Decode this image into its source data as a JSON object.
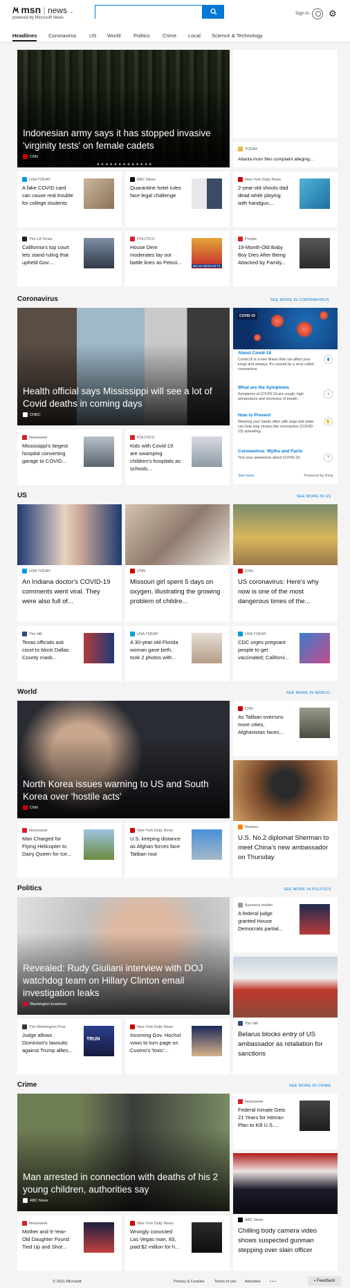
{
  "header": {
    "logo_msn": "msn",
    "logo_news": "news",
    "logo_sub": "powered by Microsoft News",
    "search_placeholder": "",
    "signin": "Sign in"
  },
  "nav": [
    "Headlines",
    "Coronavirus",
    "US",
    "World",
    "Politics",
    "Crime",
    "Local",
    "Science & Technology"
  ],
  "headlines": {
    "hero": {
      "title": "Indonesian army says it has stopped invasive 'virginity tests' on female cadets",
      "source": "CNN"
    },
    "side": {
      "source": "TODAY",
      "title": "Atlanta mom files complaint alleging..."
    },
    "row1": [
      {
        "source": "USA TODAY",
        "title": "A fake COVID card can cause real trouble for college students"
      },
      {
        "source": "BBC News",
        "title": "Quarantine hotel rules face legal challenge"
      },
      {
        "source": "New York Daily News",
        "title": "2-year-old shoots dad dead while playing with handgun,..."
      }
    ],
    "row2": [
      {
        "source": "The LA Times",
        "title": "California's top court lets stand ruling that upheld Gov...."
      },
      {
        "source": "POLITICO",
        "title": "House Dem moderates lay out battle lines as Pelosi..."
      },
      {
        "source": "People",
        "title": "19-Month-Old Baby Boy Dies After Being Attacked by Family..."
      }
    ],
    "sign_text": "BICAN RESCUE PL"
  },
  "coronavirus": {
    "section": "Coronavirus",
    "see_more": "SEE MORE IN CORONAVIRUS",
    "hero": {
      "title": "Health official says Mississippi will see a lot of Covid deaths in coming days",
      "source": "CNBC"
    },
    "row": [
      {
        "source": "Newsweek",
        "title": "Mississippi's largest hospital converting garage to COVID..."
      },
      {
        "source": "POLITICO",
        "title": "Kids with Covid-19 are swamping children's hospitals as schools..."
      }
    ],
    "panel": {
      "badge": "COVID 19",
      "items": [
        {
          "head": "About Covid-19",
          "body": "Covid-19 is a new illness that can affect your lungs and airways. It's caused by a virus called coronavirus."
        },
        {
          "head": "What are the Symptoms",
          "body": "Symptoms of COVID-19 are cough, high temperature and shortness of breath."
        },
        {
          "head": "How to Prevent",
          "body": "Washing your hands often with soap and water can help stop viruses like coronavirus (COVID-19) spreading."
        },
        {
          "head": "Coronavirus: Myths and Facts",
          "body": "Test your awareness about COVID-19."
        }
      ],
      "see_more": "See more",
      "powered": "Powered by Bing"
    }
  },
  "us": {
    "section": "US",
    "see_more": "SEE MORE IN US",
    "cards": [
      {
        "source": "USA TODAY",
        "title": "An Indiana doctor's COVID-19 comments went viral. They were also full of..."
      },
      {
        "source": "CNN",
        "title": "Missouri girl spent 5 days on oxygen, illustrating the growing problem of childre..."
      },
      {
        "source": "CNN",
        "title": "US coronavirus: Here's why now is one of the most dangerous times of the..."
      }
    ],
    "row": [
      {
        "source": "The Hill",
        "title": "Texas officials ask court to block Dallas County mask..."
      },
      {
        "source": "USA TODAY",
        "title": "A 30-year-old Florida woman gave birth, took 2 photos with..."
      },
      {
        "source": "USA TODAY",
        "title": "CDC urges pregnant people to get vaccinated; Californi..."
      }
    ]
  },
  "world": {
    "section": "World",
    "see_more": "SEE MORE IN WORLD",
    "hero": {
      "title": "North Korea issues warning to US and South Korea over 'hostile acts'",
      "source": "CNN"
    },
    "side": {
      "source": "CNN",
      "title": "As Taliban overruns more cities, Afghanistan faces..."
    },
    "medium": {
      "source": "Reuters",
      "title": "U.S. No.2 diplomat Sherman to meet China's new ambassador on Thursday"
    },
    "row": [
      {
        "source": "Newsweek",
        "title": "Man Charged for Flying Helicopter to Dairy Queen for Ice..."
      },
      {
        "source": "New York Daily News",
        "title": "U.S. keeping distance as Afghan forces face Taliban rout"
      }
    ]
  },
  "politics": {
    "section": "Politics",
    "see_more": "SEE MORE IN POLITICS",
    "hero": {
      "title": "Revealed: Rudy Giuliani interview with DOJ watchdog team on Hillary Clinton email investigation leaks",
      "source": "Washington Examiner"
    },
    "side": {
      "source": "Business Insider",
      "title": "A federal judge granted House Democrats partial..."
    },
    "medium": {
      "source": "The Hill",
      "title": "Belarus blocks entry of US ambassador as retaliation for sanctions"
    },
    "row": [
      {
        "source": "The Washington Post",
        "title": "Judge allows Dominion's lawsuits against Trump allies..."
      },
      {
        "source": "New York Daily News",
        "title": "Incoming Gov. Hochul vows to turn page on Cuomo's 'toxic'..."
      }
    ],
    "thumb_text": "TRUN"
  },
  "crime": {
    "section": "Crime",
    "see_more": "SEE MORE IN CRIME",
    "hero": {
      "title": "Man arrested in connection with deaths of his 2 young children, authorities say",
      "source": "ABC News"
    },
    "side": {
      "source": "Newsweek",
      "title": "Federal Inmate Gets 21 Years for Hitman Plan to Kill U.S...."
    },
    "medium": {
      "source": "ABC News",
      "title": "Chilling body camera video shows suspected gunman stepping over slain officer"
    },
    "row": [
      {
        "source": "Newsweek",
        "title": "Mother and 9-Year-Old Daughter Found Tied Up and Shot..."
      },
      {
        "source": "New York Daily News",
        "title": "Wrongly convicted Las Vegas man, 83, paid $2 million for h..."
      }
    ]
  },
  "footer": {
    "copyright": "© 2021 Microsoft",
    "privacy": "Privacy & Cookies",
    "terms": "Terms of use",
    "advertise": "Advertise",
    "more": "• • •",
    "feedback": "Feedback"
  }
}
